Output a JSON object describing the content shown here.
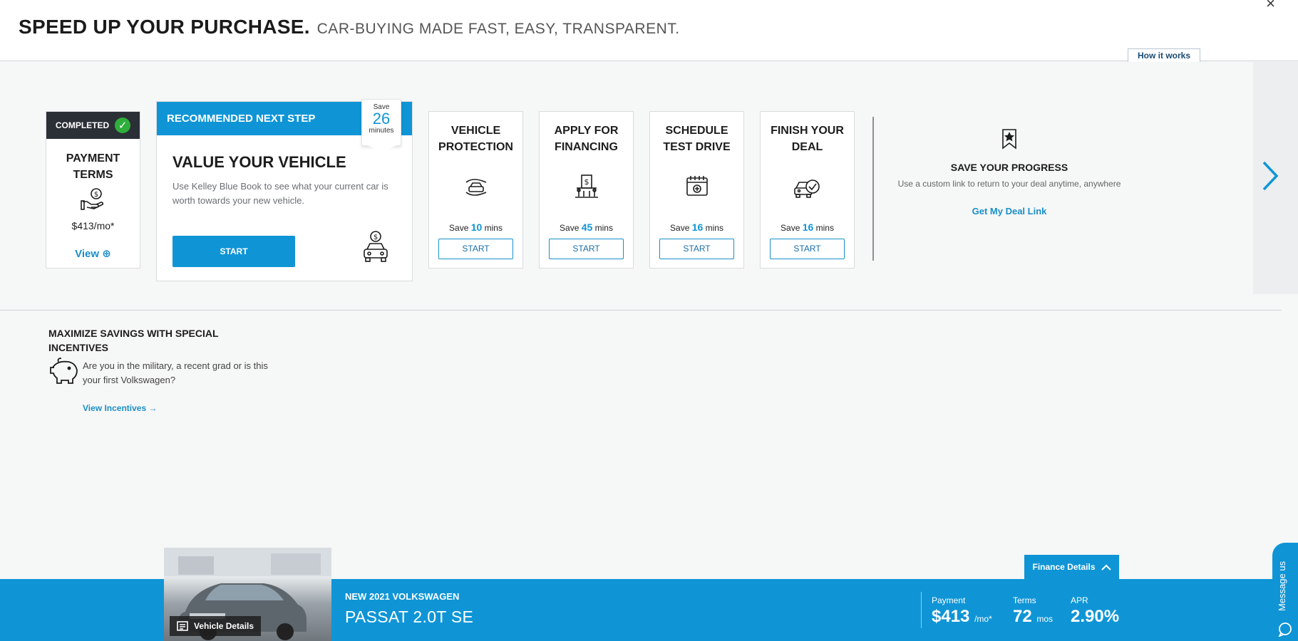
{
  "header": {
    "title_bold": "SPEED UP YOUR PURCHASE.",
    "title_light": "CAR-BUYING MADE FAST, EASY, TRANSPARENT.",
    "close_glyph": "×",
    "how_it_works": "How it works"
  },
  "completed_card": {
    "badge": "COMPLETED",
    "title": "PAYMENT TERMS",
    "icon": "hand-money-icon",
    "price": "$413/mo*",
    "link": "View"
  },
  "recommended": {
    "header": "RECOMMENDED NEXT STEP",
    "save_label": "Save",
    "save_value": "26",
    "save_unit": "minutes",
    "title": "VALUE YOUR VEHICLE",
    "description": "Use Kelley Blue Book to see what your current car is worth towards your new vehicle.",
    "button": "START",
    "icon": "car-dollar-icon"
  },
  "steps": [
    {
      "title": "VEHICLE PROTECTION",
      "icon": "hands-car-icon",
      "save_prefix": "Save",
      "minutes": "10",
      "save_suffix": "mins",
      "button": "START"
    },
    {
      "title": "APPLY FOR FINANCING",
      "icon": "bank-icon",
      "save_prefix": "Save",
      "minutes": "45",
      "save_suffix": "mins",
      "button": "START"
    },
    {
      "title": "SCHEDULE TEST DRIVE",
      "icon": "calendar-icon",
      "save_prefix": "Save",
      "minutes": "16",
      "save_suffix": "mins",
      "button": "START"
    },
    {
      "title": "FINISH YOUR DEAL",
      "icon": "car-check-icon",
      "save_prefix": "Save",
      "minutes": "16",
      "save_suffix": "mins",
      "button": "START"
    }
  ],
  "save_progress": {
    "icon": "bookmark-star-icon",
    "title": "SAVE YOUR PROGRESS",
    "description": "Use a custom link to return to your deal anytime, anywhere",
    "link": "Get My Deal Link"
  },
  "incentives": {
    "title": "MAXIMIZE SAVINGS WITH SPECIAL INCENTIVES",
    "icon": "piggy-bank-icon",
    "description": "Are you in the military, a recent grad or is this your first Volkswagen?",
    "link": "View Incentives"
  },
  "vehicle": {
    "vehicle_details_button": "Vehicle Details",
    "line1": "NEW 2021 VOLKSWAGEN",
    "line2": "PASSAT 2.0T SE"
  },
  "finance": {
    "details_button": "Finance Details",
    "payment_label": "Payment",
    "payment_value": "$413",
    "payment_unit": "/mo*",
    "terms_label": "Terms",
    "terms_value": "72",
    "terms_unit": "mos",
    "apr_label": "APR",
    "apr_value": "2.90%"
  },
  "chat": {
    "label": "Message us"
  },
  "colors": {
    "accent": "#0f95d6",
    "dark": "#2b2f36",
    "success": "#2fae3b"
  }
}
